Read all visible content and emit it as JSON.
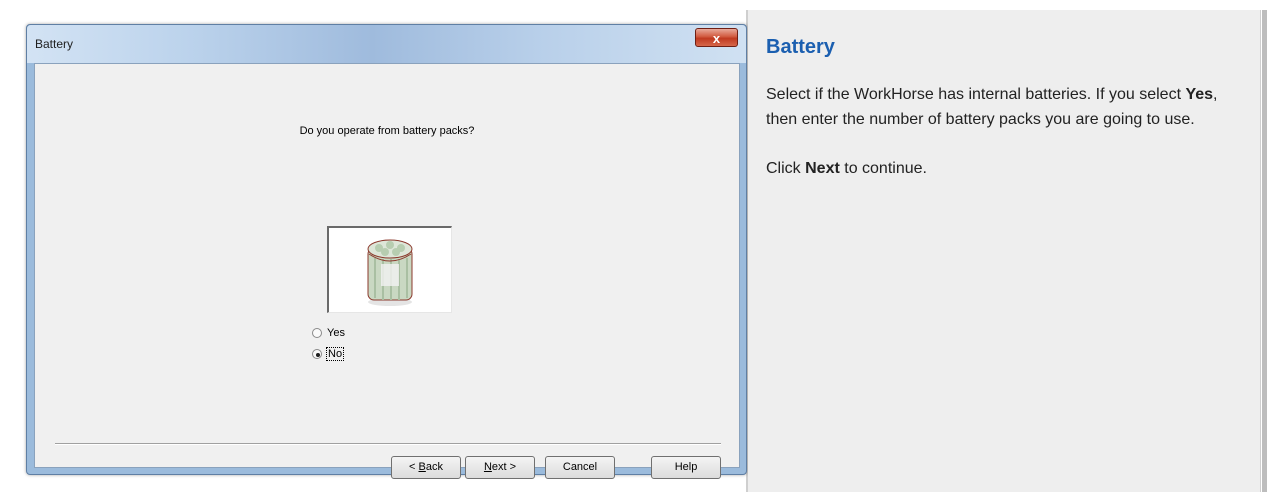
{
  "dialog": {
    "title": "Battery",
    "close_label": "x",
    "question": "Do you operate from battery packs?",
    "options": {
      "yes": "Yes",
      "no": "No",
      "selected": "No"
    },
    "buttons": {
      "back_prefix": "< ",
      "back_mnemonic": "B",
      "back_rest": "ack",
      "next_mnemonic": "N",
      "next_rest": "ext >",
      "cancel": "Cancel",
      "help": "Help"
    }
  },
  "help_panel": {
    "title": "Battery",
    "p1_a": "Select if the WorkHorse has internal batteries. If you select ",
    "p1_bold": "Yes",
    "p1_b": ", then enter the number of battery packs you are going to use.",
    "p2_a": "Click ",
    "p2_bold": "Next",
    "p2_b": " to continue."
  },
  "colors": {
    "help_title": "#1b5fb0",
    "dialog_frame": "#9bbbdc",
    "close_button": "#c8432a"
  }
}
